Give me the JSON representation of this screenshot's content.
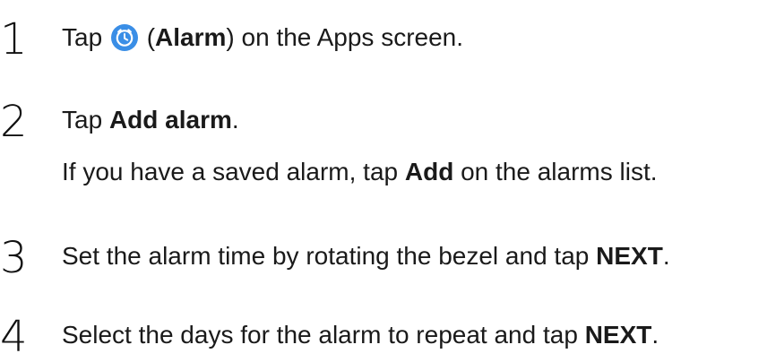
{
  "steps": [
    {
      "number": "1",
      "parts": {
        "tap": "Tap ",
        "open_paren": " (",
        "app_name": "Alarm",
        "rest": ") on the Apps screen."
      },
      "icon": "alarm-clock-icon",
      "icon_color": "#3a8ee6"
    },
    {
      "number": "2",
      "parts": {
        "tap": "Tap ",
        "bold": "Add alarm",
        "end": "."
      },
      "note": {
        "before": "If you have a saved alarm, tap ",
        "bold": "Add",
        "after": " on the alarms list."
      }
    },
    {
      "number": "3",
      "parts": {
        "text": "Set the alarm time by rotating the bezel and tap ",
        "bold": "NEXT",
        "end": "."
      }
    },
    {
      "number": "4",
      "parts": {
        "text": "Select the days for the alarm to repeat and tap ",
        "bold": "NEXT",
        "end": "."
      }
    }
  ]
}
